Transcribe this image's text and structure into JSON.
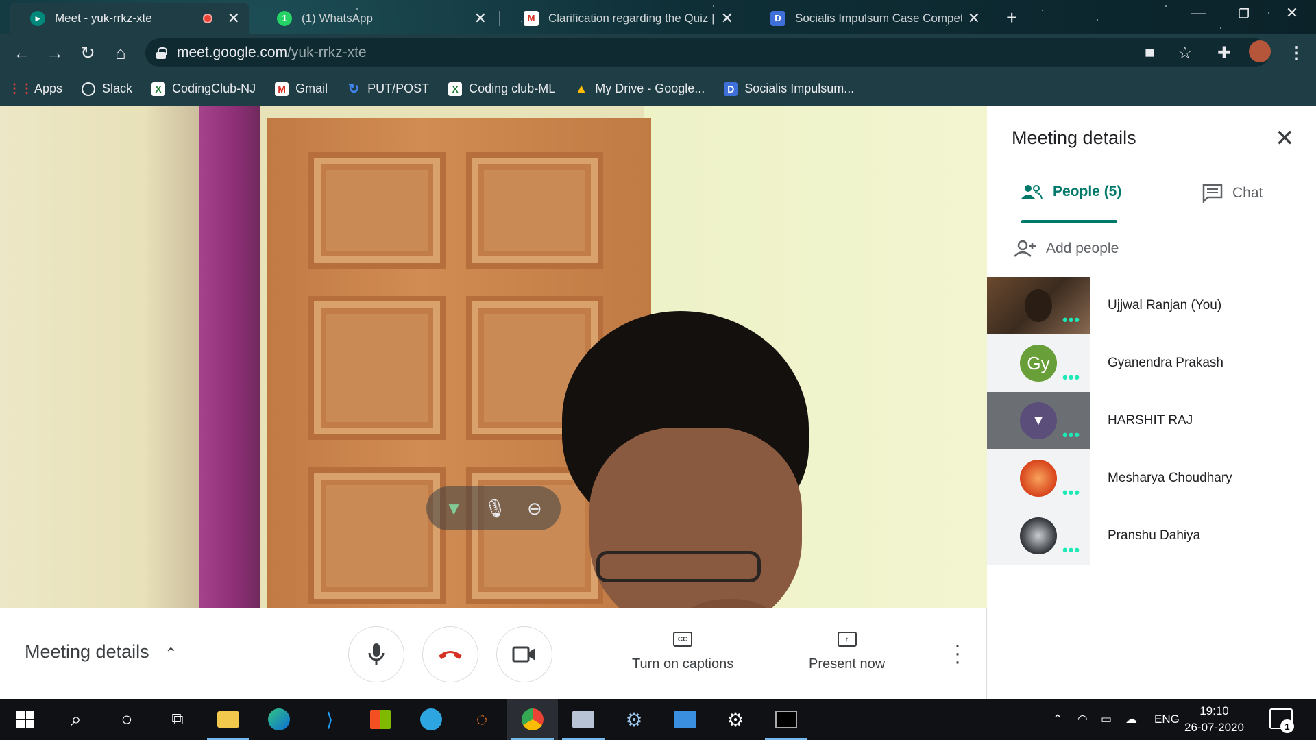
{
  "browser": {
    "tabs": [
      {
        "title": "Meet - yuk-rrkz-xte",
        "active": true,
        "recording": true
      },
      {
        "title": "(1) WhatsApp",
        "active": false,
        "favicon_text": "1"
      },
      {
        "title": "Clarification regarding the Quiz |",
        "active": false
      },
      {
        "title": "Socialis Impulsum Case Competi",
        "active": false
      }
    ],
    "url_host": "meet.google.com",
    "url_path": "/yuk-rrkz-xte",
    "bookmarks": [
      {
        "label": "Apps",
        "icon": "apps-grid-icon"
      },
      {
        "label": "Slack",
        "icon": "globe-icon"
      },
      {
        "label": "CodingClub-NJ",
        "icon": "x-sheet-icon"
      },
      {
        "label": "Gmail",
        "icon": "gmail-icon"
      },
      {
        "label": "PUT/POST",
        "icon": "loop-icon"
      },
      {
        "label": "Coding club-ML",
        "icon": "x-sheet-icon"
      },
      {
        "label": "My Drive - Google...",
        "icon": "drive-icon"
      },
      {
        "label": "Socialis Impulsum...",
        "icon": "dc-icon"
      }
    ]
  },
  "meet": {
    "controls": {
      "meeting_details_label": "Meeting details",
      "captions_label": "Turn on captions",
      "present_label": "Present now"
    },
    "side_panel": {
      "title": "Meeting details",
      "people_tab": "People (5)",
      "chat_tab": "Chat",
      "add_people": "Add people",
      "participants": [
        {
          "name": "Ujjwal Ranjan (You)",
          "thumb": "video"
        },
        {
          "name": "Gyanendra Prakash",
          "thumb": "avatar",
          "initials": "Gy",
          "color": "#689f38"
        },
        {
          "name": "HARSHIT RAJ",
          "thumb": "pinned",
          "color": "#5b4e7a"
        },
        {
          "name": "Mesharya Choudhary",
          "thumb": "avatar",
          "color": "#e65a1e"
        },
        {
          "name": "Pranshu Dahiya",
          "thumb": "avatar",
          "color": "#2f3337"
        }
      ]
    }
  },
  "taskbar": {
    "lang": "ENG",
    "time": "19:10",
    "date": "26-07-2020",
    "notification_count": "1"
  },
  "colors": {
    "accent": "#00796b",
    "end_call": "#d93025",
    "tab_bg": "#1f3d45"
  }
}
